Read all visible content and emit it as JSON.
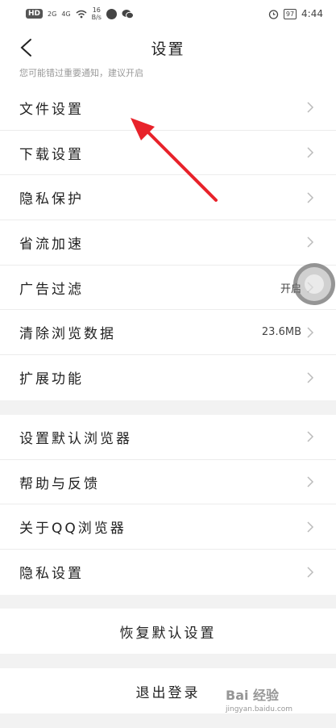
{
  "status_bar": {
    "hd": "HD",
    "net1": "2G",
    "net2": "4G",
    "speed_value": "16",
    "speed_unit": "B/s",
    "battery": "97",
    "time": "4:44"
  },
  "header": {
    "title": "设置"
  },
  "notice": {
    "text": "您可能错过重要通知，建议开启"
  },
  "group1": [
    {
      "label": "文件设置",
      "value": ""
    },
    {
      "label": "下载设置",
      "value": ""
    },
    {
      "label": "隐私保护",
      "value": ""
    },
    {
      "label": "省流加速",
      "value": ""
    },
    {
      "label": "广告过滤",
      "value": "开启"
    },
    {
      "label": "清除浏览数据",
      "value": "23.6MB"
    },
    {
      "label": "扩展功能",
      "value": ""
    }
  ],
  "group2": [
    {
      "label": "设置默认浏览器"
    },
    {
      "label": "帮助与反馈"
    },
    {
      "label": "关于QQ浏览器"
    },
    {
      "label": "隐私设置"
    }
  ],
  "buttons": {
    "restore": "恢复默认设置",
    "logout": "退出登录"
  },
  "watermark": {
    "brand": "Bai 经验",
    "site": "jingyan.baidu.com"
  },
  "colors": {
    "annotation_arrow": "#e8222a"
  }
}
